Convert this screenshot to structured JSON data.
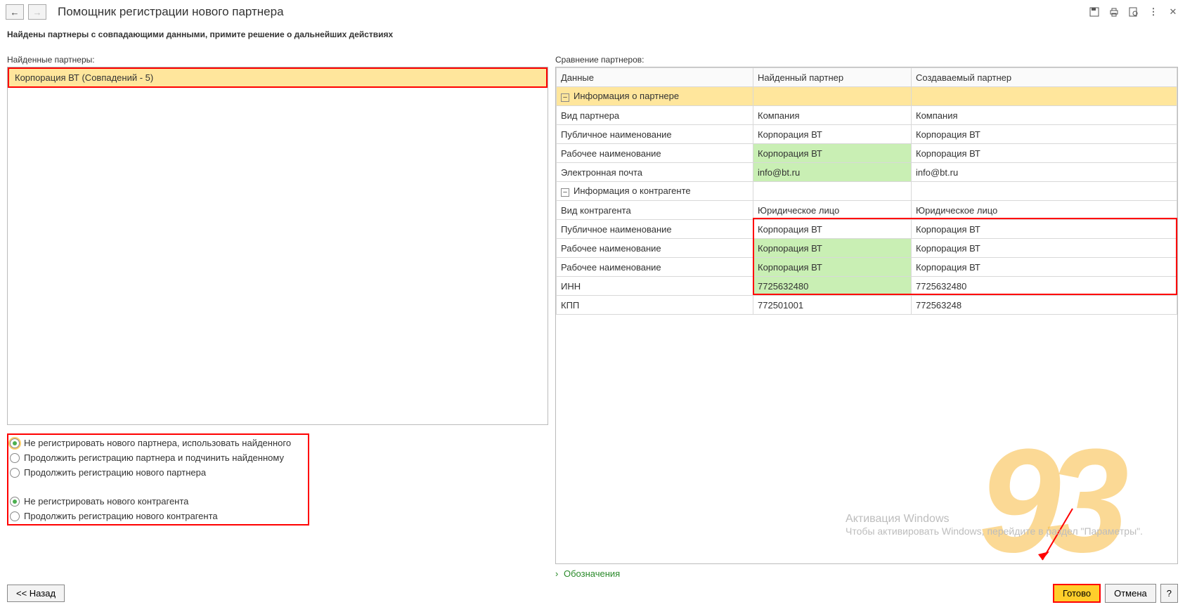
{
  "header": {
    "title": "Помощник регистрации нового партнера"
  },
  "subtitle": "Найдены партнеры с совпадающими данными, примите решение о дальнейших действиях",
  "left": {
    "found_label": "Найденные партнеры:",
    "items": [
      "Корпорация ВТ (Совпадений - 5)"
    ],
    "radios_partner": [
      "Не регистрировать нового партнера, использовать найденного",
      "Продолжить регистрацию партнера и подчинить найденному",
      "Продолжить регистрацию нового партнера"
    ],
    "radios_contragent": [
      "Не регистрировать нового контрагента",
      "Продолжить регистрацию нового контрагента"
    ]
  },
  "right": {
    "cmp_label": "Сравнение партнеров:",
    "cols": {
      "data": "Данные",
      "found": "Найденный партнер",
      "created": "Создаваемый партнер"
    },
    "group1": "Информация о партнере",
    "rows1": [
      {
        "label": "Вид партнера",
        "found": "Компания",
        "created": "Компания",
        "hl": false
      },
      {
        "label": "Публичное наименование",
        "found": "Корпорация ВТ",
        "created": "Корпорация ВТ",
        "hl": false
      },
      {
        "label": "Рабочее наименование",
        "found": "Корпорация ВТ",
        "created": "Корпорация ВТ",
        "hl": true
      },
      {
        "label": "Электронная почта",
        "found": "info@bt.ru",
        "created": "info@bt.ru",
        "hl": true
      }
    ],
    "group2": "Информация о контрагенте",
    "rows2": [
      {
        "label": "Вид контрагента",
        "found": "Юридическое лицо",
        "created": "Юридическое лицо",
        "hl": false
      },
      {
        "label": "Публичное наименование",
        "found": "Корпорация ВТ",
        "created": "Корпорация ВТ",
        "hl": false
      },
      {
        "label": "Рабочее наименование",
        "found": "Корпорация ВТ",
        "created": "Корпорация ВТ",
        "hl": true
      },
      {
        "label": "Рабочее наименование",
        "found": "Корпорация ВТ",
        "created": "Корпорация ВТ",
        "hl": true
      },
      {
        "label": "ИНН",
        "found": "7725632480",
        "created": "7725632480",
        "hl": true
      },
      {
        "label": "КПП",
        "found": "772501001",
        "created": "772563248",
        "hl": false
      }
    ],
    "legend": "Обозначения"
  },
  "footer": {
    "back": "<< Назад",
    "done": "Готово",
    "cancel": "Отмена",
    "help": "?"
  },
  "windows": {
    "title": "Активация Windows",
    "text": "Чтобы активировать Windows, перейдите в раздел \"Параметры\"."
  }
}
